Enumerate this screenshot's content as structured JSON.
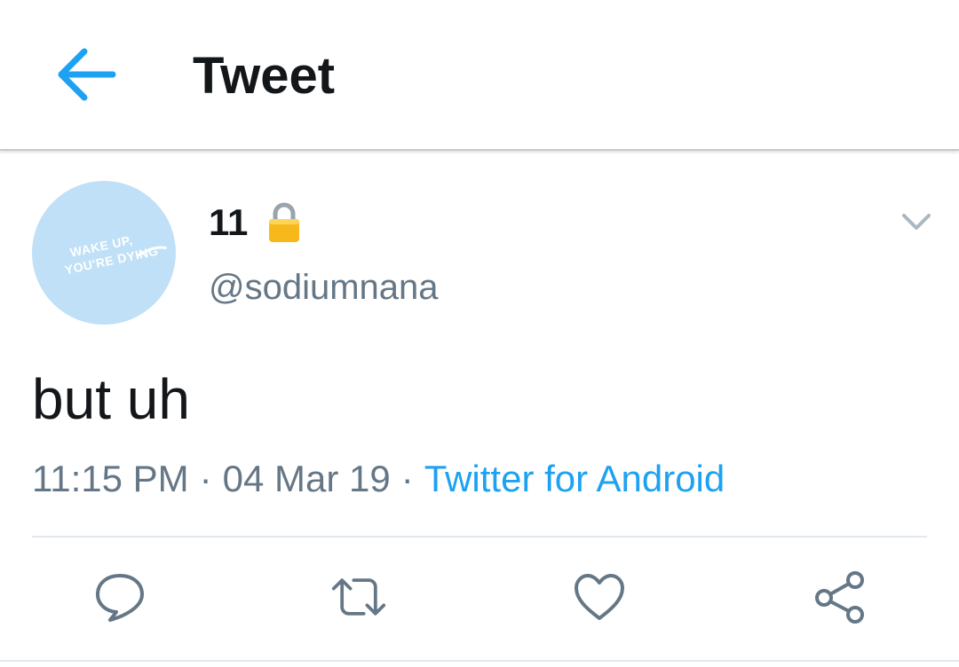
{
  "app_bar": {
    "title": "Tweet",
    "back_icon": "arrow-left-icon",
    "accent": "#1da1f2"
  },
  "tweet": {
    "avatar": {
      "line1": "WAKE UP,",
      "line2": "YOU'RE DYING",
      "background": "#bfe0f7"
    },
    "display_name": "11",
    "protected_icon": "lock-icon",
    "handle": "@sodiumnana",
    "text": "but uh",
    "time": "11:15 PM",
    "date": "04 Mar 19",
    "separator": "·",
    "source": "Twitter for Android"
  },
  "actions": [
    {
      "name": "reply",
      "icon": "reply-icon"
    },
    {
      "name": "retweet",
      "icon": "retweet-icon"
    },
    {
      "name": "like",
      "icon": "heart-icon"
    },
    {
      "name": "share",
      "icon": "share-icon"
    }
  ],
  "colors": {
    "text_primary": "#14171a",
    "text_secondary": "#657786",
    "link": "#1da1f2",
    "icon": "#657786"
  }
}
